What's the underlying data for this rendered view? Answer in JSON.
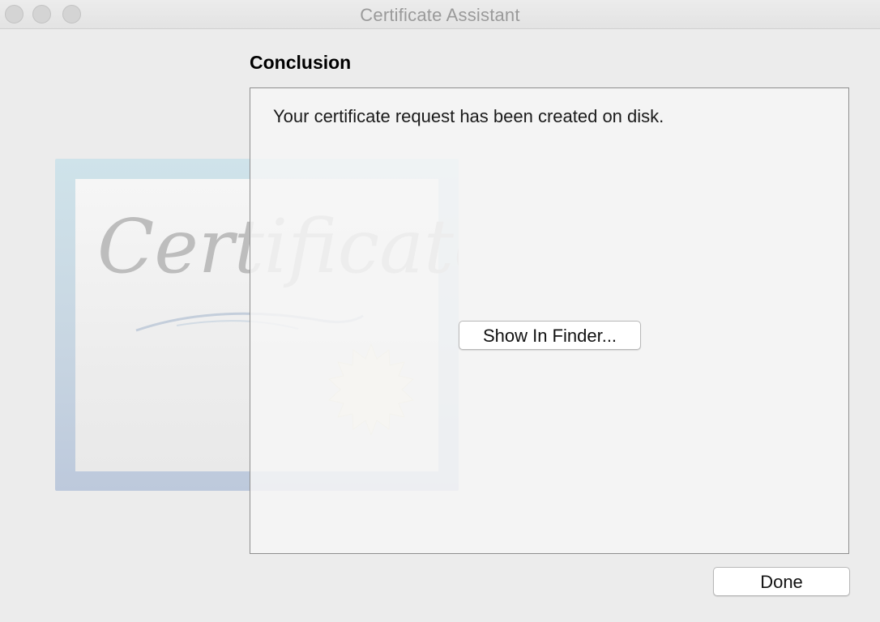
{
  "window": {
    "title": "Certificate Assistant"
  },
  "page": {
    "heading": "Conclusion",
    "message": "Your certificate request has been created on disk."
  },
  "buttons": {
    "show_in_finder": "Show In Finder...",
    "done": "Done"
  },
  "artwork": {
    "certificate_text": "Certificate"
  },
  "colors": {
    "window_bg": "#ececec",
    "panel_bg": "#f6f6f6",
    "panel_border": "#8e8e8e",
    "title_text": "#9a9a9a"
  },
  "icons": [
    "close-icon",
    "minimize-icon",
    "zoom-icon",
    "certificate-illustration",
    "seal-icon"
  ]
}
